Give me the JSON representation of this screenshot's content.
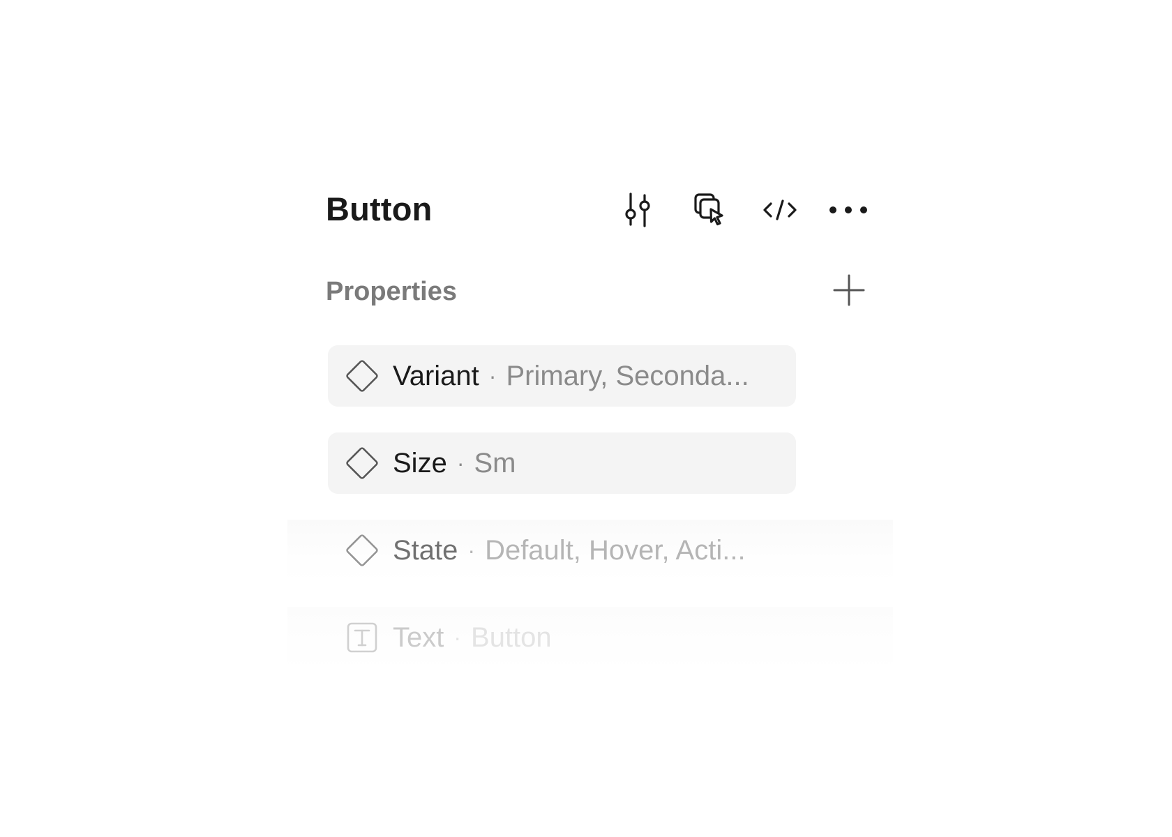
{
  "header": {
    "title": "Button",
    "actions": [
      {
        "icon": "sliders-icon"
      },
      {
        "icon": "cursor-select-icon"
      },
      {
        "icon": "code-icon"
      },
      {
        "icon": "more-icon"
      }
    ]
  },
  "properties": {
    "section_title": "Properties",
    "add_icon": "plus-icon",
    "items": [
      {
        "icon": "diamond-icon",
        "name": "Variant",
        "separator": "·",
        "value": "Primary, Seconda..."
      },
      {
        "icon": "diamond-icon",
        "name": "Size",
        "separator": "·",
        "value": "Sm"
      },
      {
        "icon": "diamond-icon",
        "name": "State",
        "separator": "·",
        "value": "Default, Hover, Acti..."
      },
      {
        "icon": "text-icon",
        "name": "Text",
        "separator": "·",
        "value": "Button"
      }
    ]
  },
  "colors": {
    "title": "#1a1a1a",
    "muted": "#7a7a7a",
    "row_background": "#f4f4f4"
  }
}
